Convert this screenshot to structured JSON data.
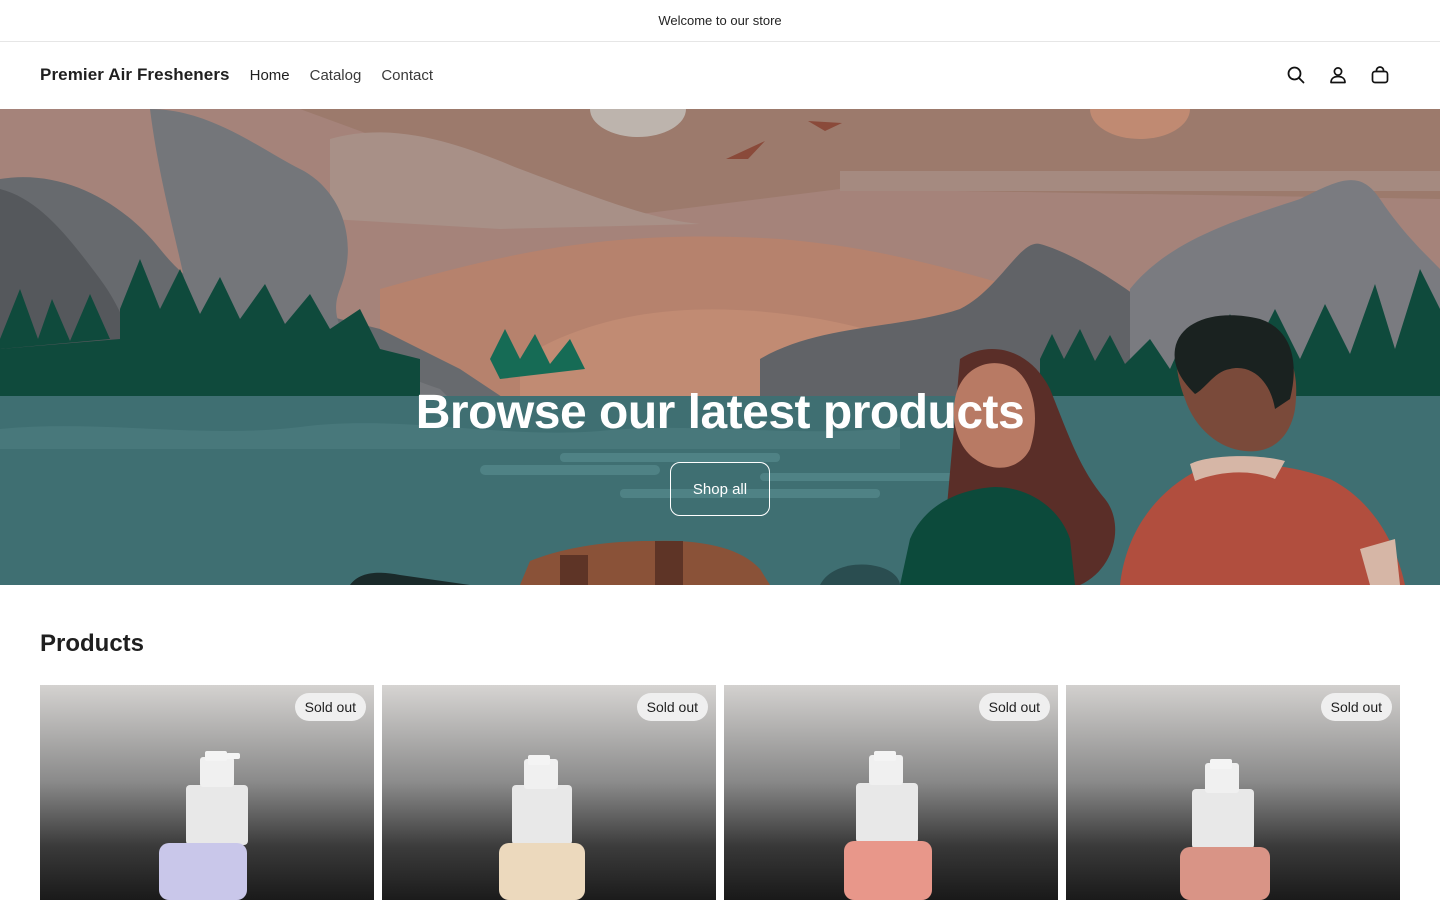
{
  "announcement": {
    "text": "Welcome to our store"
  },
  "header": {
    "logo": "Premier Air Fresheners",
    "nav": [
      {
        "label": "Home"
      },
      {
        "label": "Catalog"
      },
      {
        "label": "Contact"
      }
    ],
    "icons": [
      "search-icon",
      "account-icon",
      "cart-icon"
    ]
  },
  "hero": {
    "title": "Browse our latest products",
    "button": "Shop all"
  },
  "products": {
    "title": "Products",
    "items": [
      {
        "badge": "Sold out",
        "liquid_color": "#c9c7ea"
      },
      {
        "badge": "Sold out",
        "liquid_color": "#ecd9bd"
      },
      {
        "badge": "Sold out",
        "liquid_color": "#e8978a"
      },
      {
        "badge": "Sold out",
        "liquid_color": "#d99486"
      }
    ]
  },
  "colors": {
    "sky": "#a5837a",
    "water": "#3f6f72",
    "forest": "#0f4a3c",
    "badge_bg": "#efefef"
  }
}
